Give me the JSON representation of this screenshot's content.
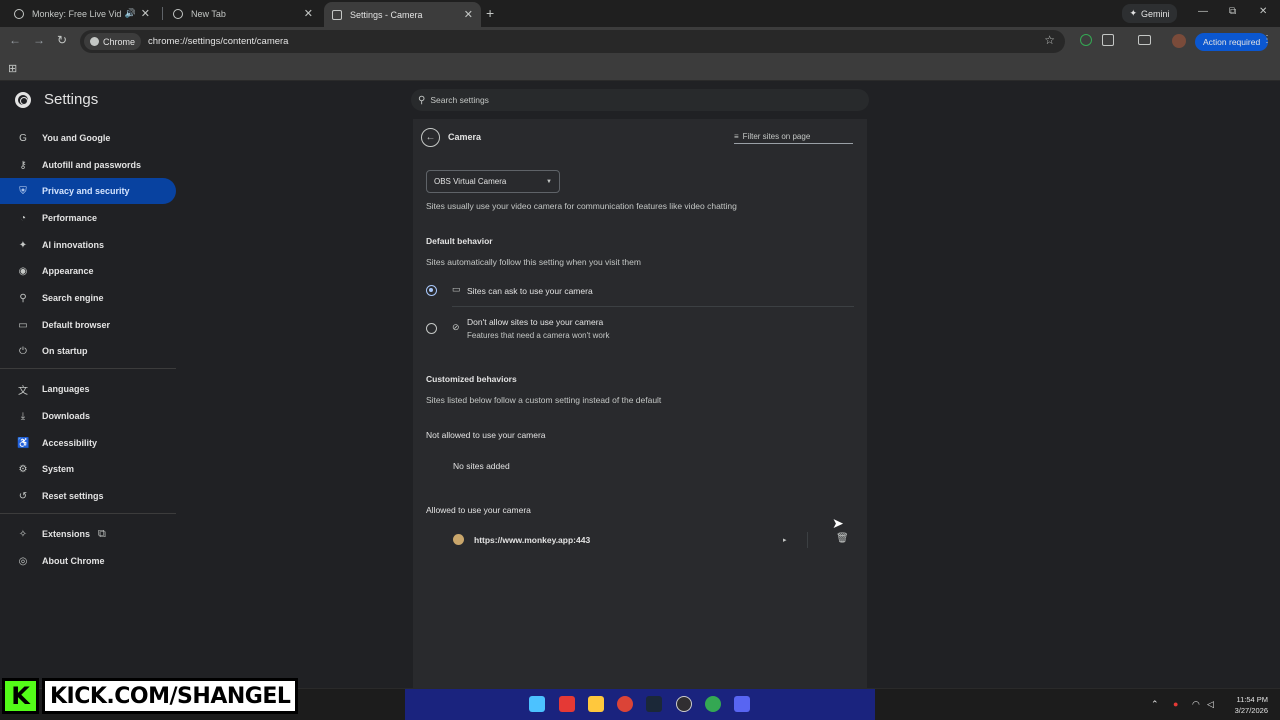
{
  "tabs": [
    {
      "title": "Monkey: Free Live Video Ch",
      "audio_icon": "🔊",
      "close": "✕"
    },
    {
      "title": "New Tab",
      "close": "✕"
    },
    {
      "title": "Settings - Camera",
      "close": "✕"
    }
  ],
  "new_tab": "+",
  "gemini_label": "Gemini",
  "window_controls": {
    "minimize": "—",
    "maximize": "⧉",
    "close": "✕"
  },
  "toolbar": {
    "back": "←",
    "forward": "→",
    "reload": "↻",
    "chip_label": "Chrome",
    "url": "chrome://settings/content/camera",
    "star": "☆",
    "action_required": "Action required",
    "menu": "⋮"
  },
  "bookmarks": {
    "apps_icon": "⊞"
  },
  "settings": {
    "title": "Settings",
    "search_placeholder": "Search settings"
  },
  "nav": [
    {
      "label": "You and Google",
      "icon": "G"
    },
    {
      "label": "Autofill and passwords",
      "icon": "⚷"
    },
    {
      "label": "Privacy and security",
      "icon": "⛨",
      "selected": true
    },
    {
      "label": "Performance",
      "icon": "◔"
    },
    {
      "label": "AI innovations",
      "icon": "✦"
    },
    {
      "label": "Appearance",
      "icon": "◉"
    },
    {
      "label": "Search engine",
      "icon": "⚲"
    },
    {
      "label": "Default browser",
      "icon": "▭"
    },
    {
      "label": "On startup",
      "icon": "⏻"
    },
    {
      "label": "Languages",
      "icon": "文"
    },
    {
      "label": "Downloads",
      "icon": "⤓"
    },
    {
      "label": "Accessibility",
      "icon": "♿"
    },
    {
      "label": "System",
      "icon": "⚙"
    },
    {
      "label": "Reset settings",
      "icon": "↺"
    },
    {
      "label": "Extensions",
      "icon": "✧",
      "external": "⧉"
    },
    {
      "label": "About Chrome",
      "icon": "◎"
    }
  ],
  "camera": {
    "back_icon": "←",
    "title": "Camera",
    "filter_placeholder": "Filter sites on page",
    "device": "OBS Virtual Camera",
    "device_caret": "▼",
    "intro": "Sites usually use your video camera for communication features like video chatting",
    "default_heading": "Default behavior",
    "default_sub": "Sites automatically follow this setting when you visit them",
    "option_allow": {
      "label": "Sites can ask to use your camera",
      "icon": "▭"
    },
    "option_block": {
      "label": "Don't allow sites to use your camera",
      "sub": "Features that need a camera won't work",
      "icon": "⊘"
    },
    "custom_heading": "Customized behaviors",
    "custom_sub": "Sites listed below follow a custom setting instead of the default",
    "not_allowed_heading": "Not allowed to use your camera",
    "no_sites": "No sites added",
    "allowed_heading": "Allowed to use your camera",
    "allowed_sites": [
      {
        "url": "https://www.monkey.app:443",
        "arrow": "▸",
        "delete": "🗑"
      }
    ]
  },
  "taskbar": {
    "tray_up": "⌃",
    "time": "11:54 PM",
    "date": "3/27/2026"
  },
  "overlay": {
    "k": "K",
    "text": "KICK.COM/SHANGEL"
  },
  "colors": {
    "accent": "#a8c7fa",
    "selected_nav": "#0842a0",
    "kick_green": "#53fc18",
    "action_blue": "#0b57d0"
  }
}
